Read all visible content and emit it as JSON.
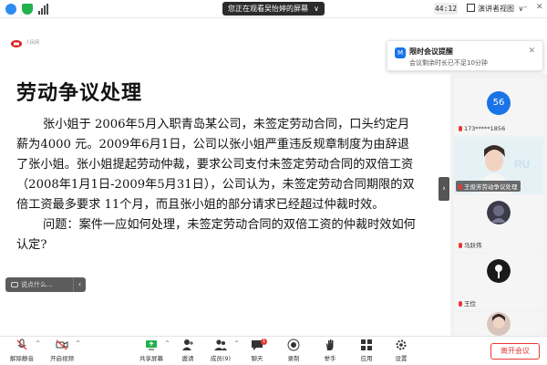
{
  "topbar": {
    "viewing_text": "您正在观看吴怡婷的屏幕",
    "viewing_caret": "∨",
    "timer": "44:12",
    "view_label": "演讲者视图",
    "view_caret": "∨",
    "minimize": "–",
    "close": "✕"
  },
  "slide": {
    "logo_text": "人民网",
    "title": "劳动争议处理",
    "paragraph1": "张小姐于 2006年5月入职青岛某公司，未签定劳动合同，口头约定月薪为4000 元。2009年6月1日，公司以张小姐严重违反规章制度为由辞退了张小姐。张小姐提起劳动仲裁，要求公司支付未签定劳动合同的双倍工资（2008年1月1日-2009年5月31日），公司认为，未签定劳动合同期限的双倍工资最多要求 11个月，而且张小姐的部分请求已经超过仲裁时效。",
    "paragraph2": "问题：案件一应如何处理，未签定劳动合同的双倍工资的仲裁时效如何认定?"
  },
  "chat": {
    "placeholder": "说点什么...",
    "arrow": "‹"
  },
  "collapse_arrow": "›",
  "notice": {
    "title": "限时会议提醒",
    "subtitle": "会议剩余时长已不足10分钟",
    "close": "✕",
    "icon_text": "M"
  },
  "participants": [
    {
      "name": "173*****1856",
      "avatar_text": "56"
    },
    {
      "name": "王俊芳劳动争议处理"
    },
    {
      "name": "马跃伟"
    },
    {
      "name": "王俭"
    },
    {
      "name": ""
    }
  ],
  "toolbar": {
    "mute": "解除静音",
    "video": "开启视频",
    "share": "共享屏幕",
    "invite": "邀请",
    "members": "成员(9)",
    "chat": "聊天",
    "chat_badge": "1",
    "record": "录制",
    "raise_hand": "举手",
    "apps": "应用",
    "settings": "设置",
    "leave": "离开会议",
    "caret": "^"
  },
  "colors": {
    "accent_blue": "#1a73e8",
    "leave_red": "#e53935"
  }
}
